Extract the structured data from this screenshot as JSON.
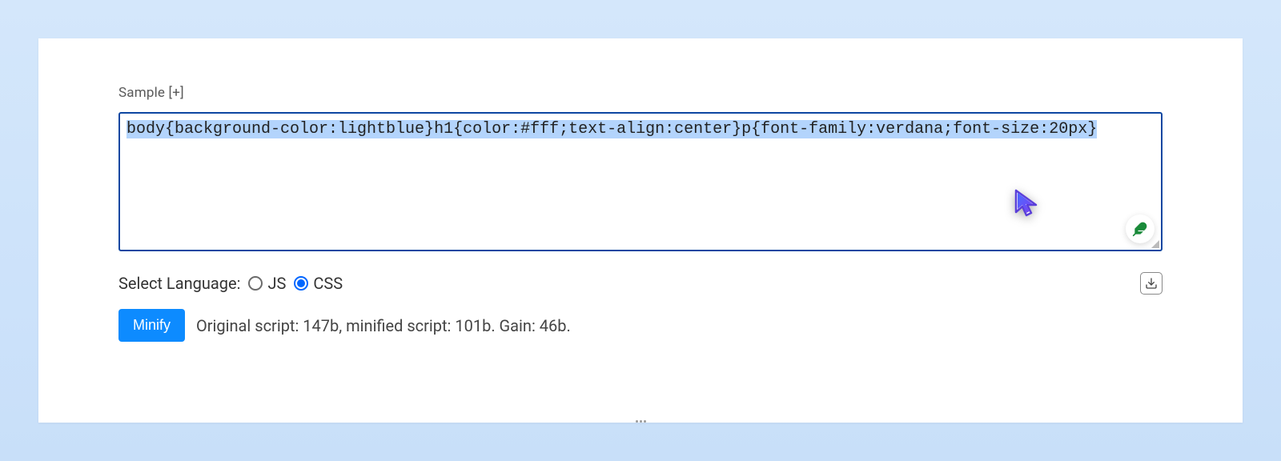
{
  "label": {
    "sample": "Sample [+]"
  },
  "textarea": {
    "code": "body{background-color:lightblue}h1{color:#fff;text-align:center}p{font-family:verdana;font-size:20px}"
  },
  "language": {
    "label": "Select Language:",
    "options": [
      {
        "value": "JS",
        "checked": false
      },
      {
        "value": "CSS",
        "checked": true
      }
    ]
  },
  "actions": {
    "minify": "Minify",
    "download_title": "Download"
  },
  "result": {
    "text": "Original script: 147b, minified script: 101b. Gain: 46b."
  },
  "icons": {
    "feather": "feather-icon",
    "download": "download-icon"
  }
}
